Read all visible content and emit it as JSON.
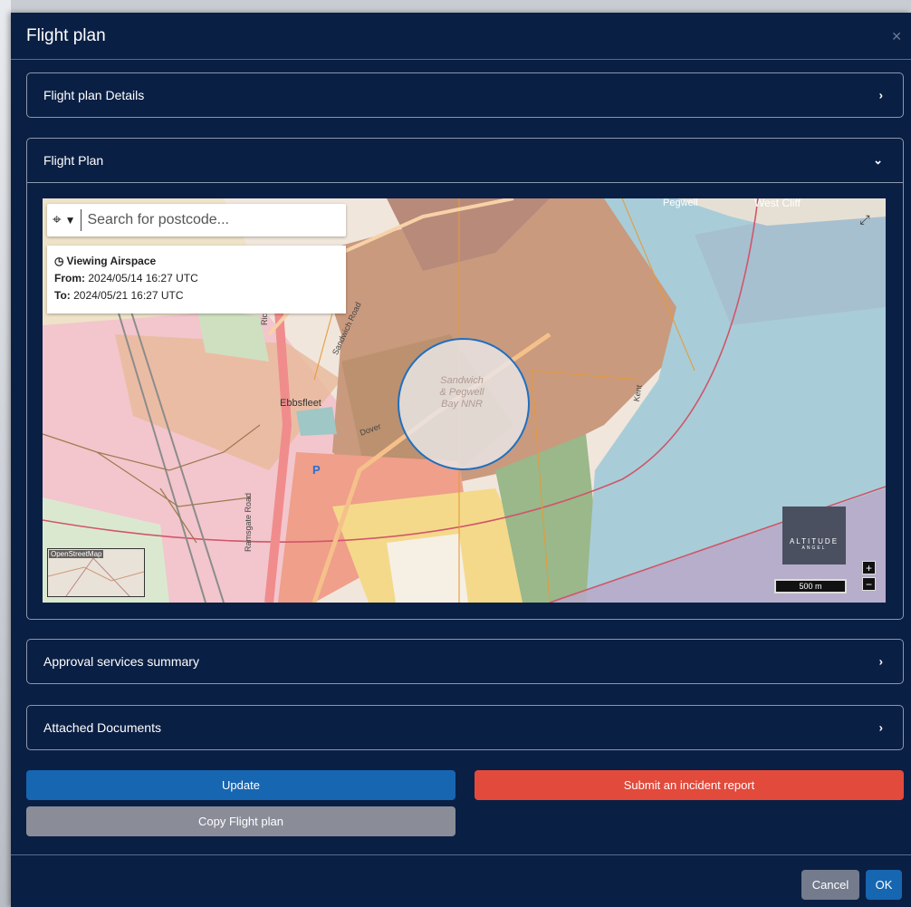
{
  "modal": {
    "title": "Flight plan",
    "close_icon": "close-icon"
  },
  "panels": {
    "details": {
      "label": "Flight plan Details",
      "chevron": "›"
    },
    "flight_plan": {
      "label": "Flight Plan",
      "chevron": "⌄"
    },
    "approval": {
      "label": "Approval services summary",
      "chevron": "›"
    },
    "documents": {
      "label": "Attached Documents",
      "chevron": "›"
    }
  },
  "map": {
    "search_placeholder": "Search for postcode...",
    "airspace": {
      "title": "Viewing Airspace",
      "from_label": "From:",
      "from_value": "2024/05/14 16:27 UTC",
      "to_label": "To:",
      "to_value": "2024/05/21 16:27 UTC"
    },
    "circle_label_1": "Sandwich",
    "circle_label_2": "& Pegwell",
    "circle_label_3": "Bay NNR",
    "place_ebbsfleet": "Ebbsfleet",
    "place_pegwell": "Pegwell",
    "place_westcliff": "West Cliff",
    "road_richborough": "Richborough",
    "road_ramsgate": "Ramsgate Road",
    "road_sandwich": "Sandwich Road",
    "road_dover": "Dover",
    "road_kent": "Kent",
    "minimap_label": "OpenStreetMap",
    "brand_line1": "ALTITUDE",
    "brand_line2": "ANGEL",
    "scale": "500 m",
    "zoom_in": "+",
    "zoom_out": "−",
    "parking": "P"
  },
  "buttons": {
    "update": "Update",
    "incident": "Submit an incident report",
    "copy": "Copy Flight plan",
    "cancel": "Cancel",
    "ok": "OK"
  },
  "colors": {
    "modal_bg": "#0a1f44",
    "primary": "#1766b1",
    "danger": "#e24a3b",
    "secondary": "#8a8d98",
    "circle_stroke": "#1f6fbf"
  }
}
